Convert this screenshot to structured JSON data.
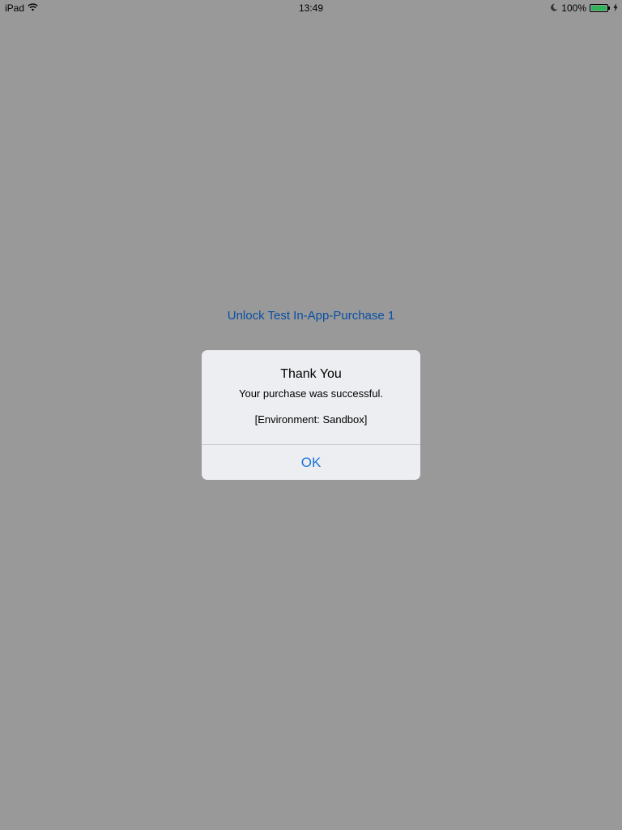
{
  "status_bar": {
    "device": "iPad",
    "time": "13:49",
    "battery_percent": "100%",
    "battery_level": 1.0
  },
  "background": {
    "unlock_label": "Unlock Test In-App-Purchase 1"
  },
  "alert": {
    "title": "Thank You",
    "message": "Your purchase was successful.",
    "environment": "[Environment: Sandbox]",
    "ok_label": "OK"
  },
  "colors": {
    "background": "#999999",
    "link": "#0a4fa3",
    "alert_button": "#1a74d6",
    "battery": "#2fb45a"
  }
}
